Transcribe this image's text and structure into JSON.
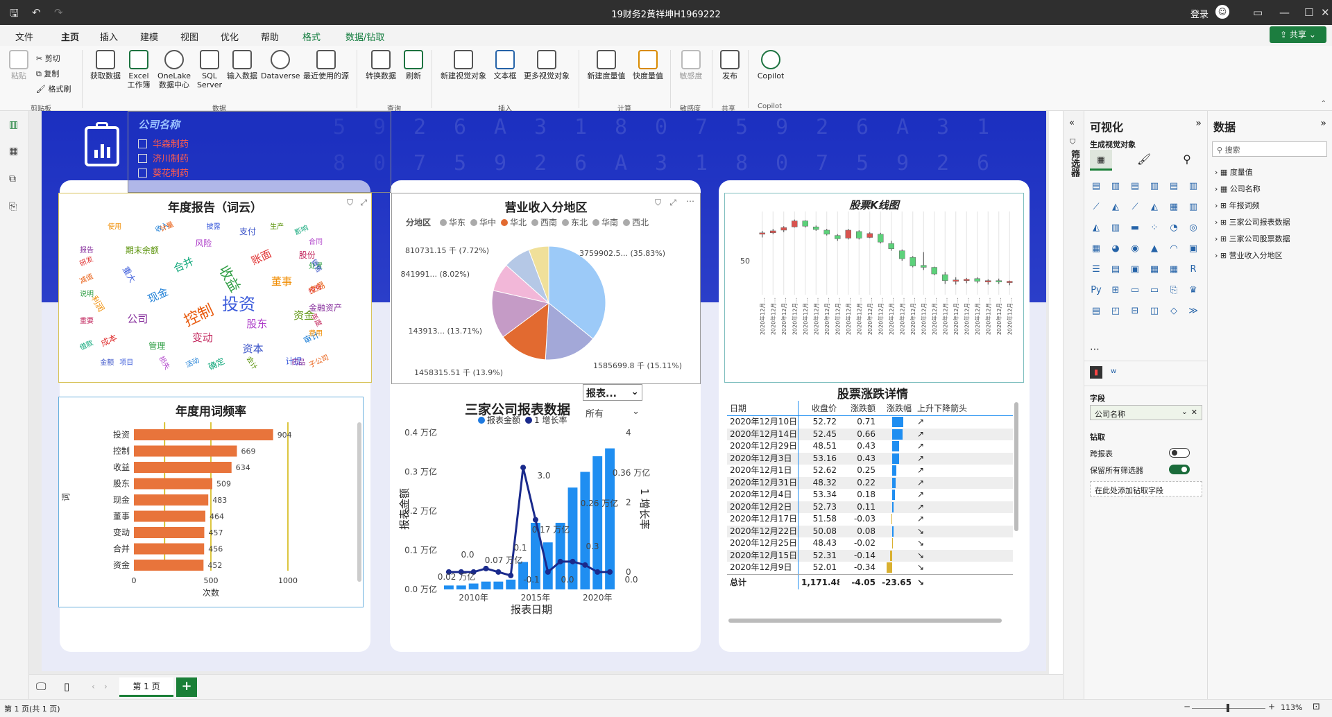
{
  "window": {
    "title": "19财务2黄祥坤H1969222",
    "login": "登录"
  },
  "menu": {
    "items": [
      "文件",
      "主页",
      "插入",
      "建模",
      "视图",
      "优化",
      "帮助",
      "格式",
      "数据/钻取"
    ],
    "share": "共享"
  },
  "ribbon": {
    "clipboard": {
      "paste": "粘贴",
      "cut": "剪切",
      "copy": "复制",
      "format": "格式刷",
      "group": "剪贴板"
    },
    "data": {
      "get": "获取数据",
      "excel": "Excel\n工作簿",
      "onelake": "OneLake\n数据中心",
      "sql": "SQL\nServer",
      "enter": "输入数据",
      "dataverse": "Dataverse",
      "recent": "最近使用的源",
      "group": "数据"
    },
    "query": {
      "transform": "转换数据",
      "refresh": "刷新",
      "group": "查询"
    },
    "insert": {
      "newvisual": "新建视觉对象",
      "textbox": "文本框",
      "more": "更多视觉对象",
      "group": "插入"
    },
    "calc": {
      "measure": "新建度量值",
      "quick": "快度量值",
      "group": "计算"
    },
    "sens": {
      "label": "敏感度",
      "group": "敏感度"
    },
    "share": {
      "publish": "发布",
      "group": "共享"
    },
    "copilot": {
      "label": "Copilot",
      "group": "Copilot"
    }
  },
  "slicer": {
    "title": "公司名称",
    "items": [
      "华森制药",
      "济川制药",
      "葵花制药"
    ]
  },
  "wordcloud": {
    "title": "年度报告（词云）",
    "words": [
      "投资",
      "控制",
      "收益",
      "股东",
      "现金",
      "董事",
      "变动",
      "合并",
      "资金",
      "公司",
      "账面",
      "资本",
      "重大",
      "交易",
      "管理",
      "风险",
      "审计",
      "利润",
      "股份",
      "确定",
      "期末余额",
      "金融资产",
      "成本",
      "支付",
      "计提",
      "减值",
      "处置",
      "损失",
      "收入",
      "费用",
      "重要",
      "影响",
      "会计",
      "报告",
      "持有",
      "金额",
      "披露",
      "子公司",
      "说明",
      "合同",
      "活动",
      "使用",
      "年度",
      "借款",
      "生产",
      "药品",
      "研发",
      "销售",
      "项目",
      "计量"
    ]
  },
  "pie": {
    "title": "营业收入分地区",
    "legend_title": "分地区",
    "legend": [
      "华东",
      "华中",
      "华北",
      "西南",
      "东北",
      "华南",
      "西北"
    ],
    "colors": [
      "#9ccaf8",
      "#a3a8d8",
      "#e26a30",
      "#c59bc6",
      "#f2b7d8",
      "#b5c8e6",
      "#f0e09a"
    ],
    "slice_labels": [
      "3759902.5... (35.83%)",
      "1585699.8 千 (15.11%)",
      "1458315.51 千 (13.9%)",
      "143913... (13.71%)",
      "841991... (8.02%)",
      "810731.15 千 (7.72%)"
    ]
  },
  "kline": {
    "title": "股票K线图",
    "y_tick": "50",
    "x_label": "2020年12月..."
  },
  "freq": {
    "title": "年度用词频率",
    "xlabel": "次数",
    "ylabel": "词",
    "xticks": [
      "0",
      "500",
      "1000"
    ]
  },
  "combo": {
    "title": "三家公司报表数据",
    "legend": [
      "报表金额",
      "1 增长率"
    ],
    "dropdown": "报表...",
    "dropdown2": "所有",
    "xlabel": "报表日期",
    "ylabel": "报表金额",
    "ylabel2": "1 增长率",
    "yticks": [
      "0.0 万亿",
      "0.1 万亿",
      "0.2 万亿",
      "0.3 万亿",
      "0.4 万亿"
    ],
    "y2ticks": [
      "0",
      "2",
      "4"
    ],
    "xticks": [
      "2010年",
      "2015年",
      "2020年"
    ],
    "annotations": [
      "0.02 万亿",
      "0.07 万亿",
      "0.17 万亿",
      "0.26 万亿",
      "0.36 万亿",
      "0.0",
      "0.1",
      "3.0",
      "-0.1",
      "0.0",
      "0.3",
      "0.0"
    ]
  },
  "table": {
    "title": "股票涨跌详情",
    "headers": [
      "日期",
      "收盘价",
      "涨跌额",
      "涨跌幅",
      "上升下降箭头"
    ],
    "rows": [
      [
        "2020年12月10日",
        "52.72",
        "0.71",
        "↗"
      ],
      [
        "2020年12月14日",
        "52.45",
        "0.66",
        "↗"
      ],
      [
        "2020年12月29日",
        "48.51",
        "0.43",
        "↗"
      ],
      [
        "2020年12月3日",
        "53.16",
        "0.43",
        "↗"
      ],
      [
        "2020年12月1日",
        "52.62",
        "0.25",
        "↗"
      ],
      [
        "2020年12月31日",
        "48.32",
        "0.22",
        "↗"
      ],
      [
        "2020年12月4日",
        "53.34",
        "0.18",
        "↗"
      ],
      [
        "2020年12月2日",
        "52.73",
        "0.11",
        "↗"
      ],
      [
        "2020年12月17日",
        "51.58",
        "-0.03",
        "↗"
      ],
      [
        "2020年12月22日",
        "50.08",
        "0.08",
        "↘"
      ],
      [
        "2020年12月25日",
        "48.43",
        "-0.02",
        "↘"
      ],
      [
        "2020年12月15日",
        "52.31",
        "-0.14",
        "↘"
      ],
      [
        "2020年12月9日",
        "52.01",
        "-0.34",
        "↘"
      ]
    ],
    "total": [
      "总计",
      "1,171.48",
      "-4.05",
      "-23.65",
      "↘"
    ]
  },
  "filter_pane": {
    "label": "筛选器"
  },
  "viz_pane": {
    "title": "可视化",
    "subtitle": "生成视觉对象",
    "fields_label": "字段",
    "field_value": "公司名称",
    "drill": "钻取",
    "cross_report": "跨报表",
    "keep_filters": "保留所有筛选器",
    "add_drill": "在此处添加钻取字段"
  },
  "data_pane": {
    "title": "数据",
    "search": "搜索",
    "items": [
      "度量值",
      "公司名称",
      "年报词频",
      "三家公司报表数据",
      "三家公司股票数据",
      "营业收入分地区"
    ]
  },
  "pages": {
    "page1": "第 1 页"
  },
  "status": {
    "left": "第 1 页(共 1 页)",
    "zoom": "113%"
  },
  "chart_data": [
    {
      "type": "bar",
      "title": "年度用词频率",
      "categories": [
        "投资",
        "控制",
        "收益",
        "股东",
        "现金",
        "董事",
        "变动",
        "合并",
        "资金"
      ],
      "values": [
        904,
        669,
        634,
        509,
        483,
        464,
        457,
        456,
        452
      ],
      "xlabel": "次数",
      "ylabel": "词",
      "xlim": [
        0,
        1000
      ]
    },
    {
      "type": "pie",
      "title": "营业收入分地区",
      "categories": [
        "华东",
        "华中",
        "华北",
        "西南",
        "东北",
        "华南",
        "西北"
      ],
      "values": [
        35.83,
        15.11,
        13.9,
        13.71,
        8.02,
        7.72,
        5.71
      ]
    },
    {
      "type": "bar",
      "title": "三家公司报表数据",
      "x": [
        2008,
        2009,
        2010,
        2011,
        2012,
        2013,
        2014,
        2015,
        2016,
        2017,
        2018,
        2019,
        2020,
        2021
      ],
      "series": [
        {
          "name": "报表金额",
          "values": [
            0.01,
            0.01,
            0.015,
            0.02,
            0.02,
            0.025,
            0.07,
            0.17,
            0.12,
            0.17,
            0.26,
            0.3,
            0.34,
            0.36
          ]
        },
        {
          "name": "1 增长率",
          "values": [
            0.0,
            0.0,
            0.0,
            0.1,
            0.0,
            -0.1,
            3.0,
            1.5,
            0.0,
            0.3,
            0.3,
            0.2,
            0.0,
            0.0
          ]
        }
      ],
      "xlabel": "报表日期",
      "ylabel": "报表金额",
      "ylim": [
        0,
        0.4
      ],
      "y2lim": [
        -0.5,
        4
      ]
    },
    {
      "type": "line",
      "title": "股票K线图",
      "values": [
        [
          54.0,
          54.5,
          53.5,
          54.2
        ],
        [
          54.2,
          54.8,
          54.0,
          54.5
        ],
        [
          54.6,
          55.2,
          54.3,
          55.0
        ],
        [
          55.1,
          56.2,
          55.0,
          56.0
        ],
        [
          56.0,
          56.1,
          55.0,
          55.2
        ],
        [
          55.1,
          55.3,
          54.5,
          54.7
        ],
        [
          54.6,
          54.8,
          53.8,
          54.0
        ],
        [
          53.8,
          54.0,
          53.0,
          53.3
        ],
        [
          53.4,
          54.8,
          53.2,
          54.6
        ],
        [
          54.4,
          54.6,
          53.2,
          53.4
        ],
        [
          53.5,
          54.3,
          53.4,
          54.1
        ],
        [
          54.0,
          54.2,
          52.6,
          52.8
        ],
        [
          52.6,
          53.0,
          51.5,
          51.8
        ],
        [
          51.5,
          51.7,
          50.0,
          50.3
        ],
        [
          50.5,
          50.7,
          49.0,
          49.2
        ],
        [
          49.3,
          51.3,
          48.6,
          49.0
        ],
        [
          49.0,
          49.1,
          47.8,
          48.0
        ],
        [
          47.9,
          48.3,
          46.5,
          47.0
        ],
        [
          47.0,
          47.5,
          46.4,
          47.1
        ],
        [
          47.0,
          47.4,
          46.6,
          47.2
        ],
        [
          47.3,
          47.5,
          46.6,
          46.9
        ],
        [
          46.8,
          47.2,
          46.4,
          47.0
        ],
        [
          47.0,
          47.3,
          46.5,
          46.8
        ],
        [
          46.7,
          47.0,
          46.3,
          46.9
        ]
      ]
    }
  ]
}
